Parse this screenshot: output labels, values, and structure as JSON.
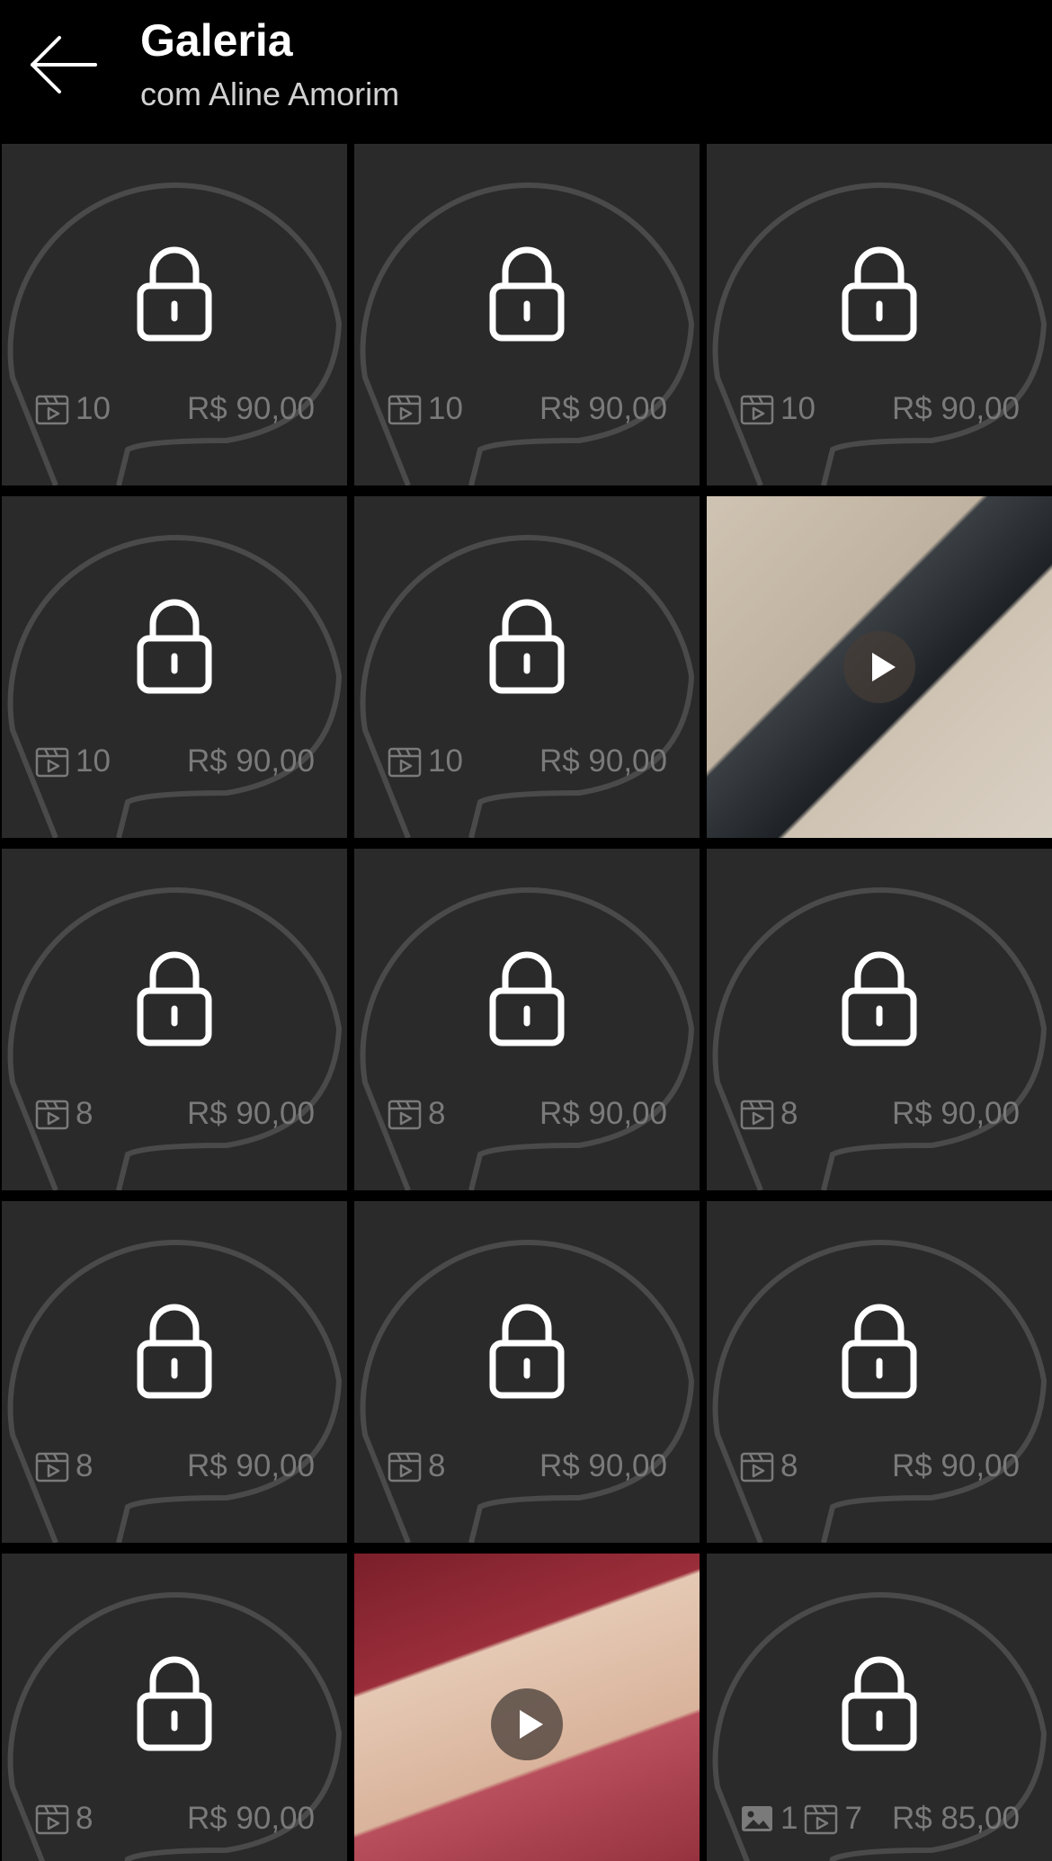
{
  "header": {
    "title": "Galeria",
    "subtitle": "com Aline Amorim",
    "back_icon": "arrow-left-icon"
  },
  "icons": {
    "lock": "lock-icon",
    "video": "video-icon",
    "image": "image-icon",
    "play": "play-icon"
  },
  "colors": {
    "background": "#000000",
    "tile": "#2a2a2a",
    "meta_text": "#7a7a7a"
  },
  "gallery": {
    "items": [
      {
        "locked": true,
        "video_count": "10",
        "price": "R$ 90,00"
      },
      {
        "locked": true,
        "video_count": "10",
        "price": "R$ 90,00"
      },
      {
        "locked": true,
        "video_count": "10",
        "price": "R$ 90,00"
      },
      {
        "locked": true,
        "video_count": "10",
        "price": "R$ 90,00"
      },
      {
        "locked": true,
        "video_count": "10",
        "price": "R$ 90,00"
      },
      {
        "locked": false,
        "media": "video"
      },
      {
        "locked": true,
        "video_count": "8",
        "price": "R$ 90,00"
      },
      {
        "locked": true,
        "video_count": "8",
        "price": "R$ 90,00"
      },
      {
        "locked": true,
        "video_count": "8",
        "price": "R$ 90,00"
      },
      {
        "locked": true,
        "video_count": "8",
        "price": "R$ 90,00"
      },
      {
        "locked": true,
        "video_count": "8",
        "price": "R$ 90,00"
      },
      {
        "locked": true,
        "video_count": "8",
        "price": "R$ 90,00"
      },
      {
        "locked": true,
        "video_count": "8",
        "price": "R$ 90,00"
      },
      {
        "locked": false,
        "media": "video"
      },
      {
        "locked": true,
        "image_count": "1",
        "video_count": "7",
        "price": "R$ 85,00"
      }
    ]
  }
}
